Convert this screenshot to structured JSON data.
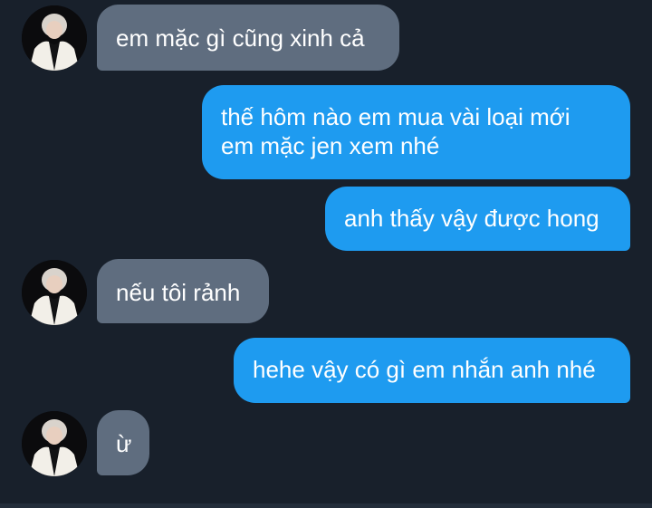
{
  "conversation": {
    "messages": [
      {
        "from": "contact",
        "text": "em mặc gì cũng xinh cả"
      },
      {
        "from": "me",
        "lines": [
          "thế hôm nào em mua vài loại mới",
          "em mặc jen xem nhé"
        ]
      },
      {
        "from": "me",
        "text": "anh thấy vậy được hong"
      },
      {
        "from": "contact",
        "text": "nếu tôi rảnh"
      },
      {
        "from": "me",
        "text": "hehe vậy có gì em nhắn anh nhé"
      },
      {
        "from": "contact",
        "text": "ừ"
      }
    ]
  },
  "colors": {
    "background": "#18202b",
    "incoming_bubble": "#5f6d7f",
    "outgoing_bubble": "#1e9bf0",
    "text": "#ffffff"
  },
  "icons": {
    "contact_avatar": "profile-photo-avatar"
  }
}
